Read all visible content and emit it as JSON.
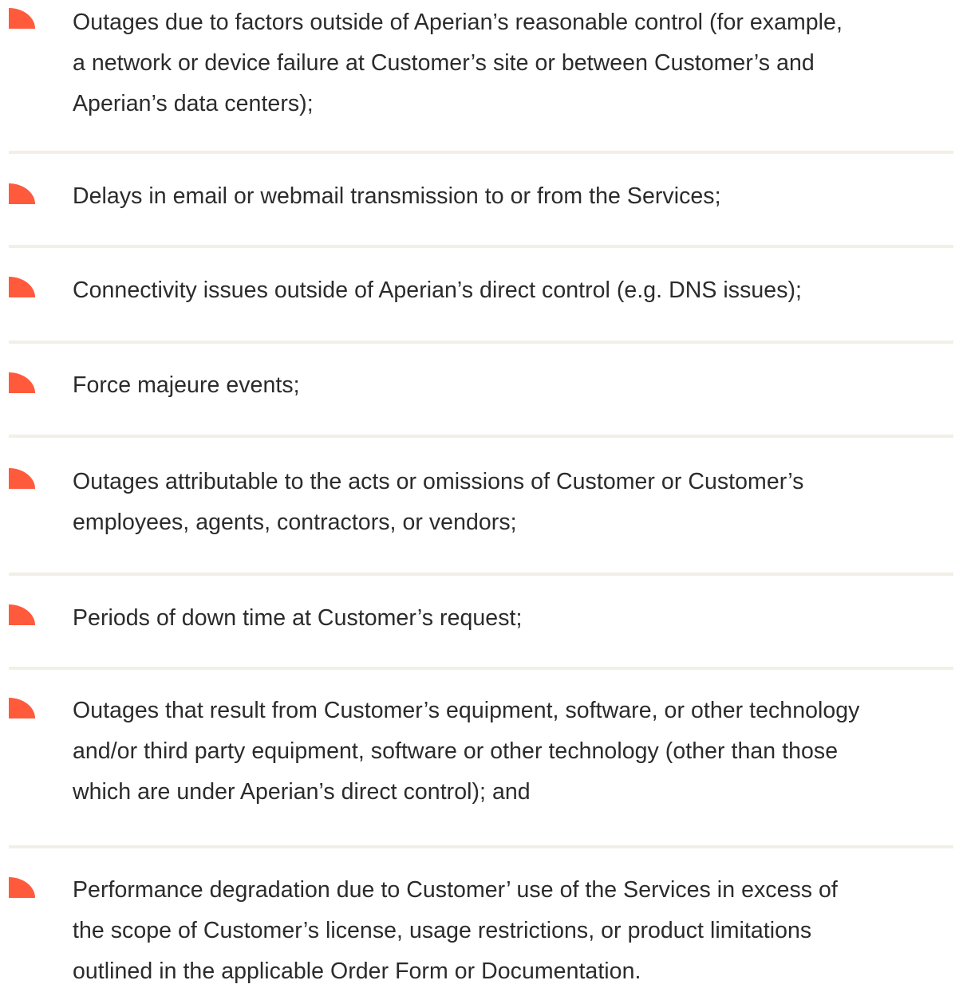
{
  "list": {
    "items": [
      {
        "lines": [
          "Outages due to factors outside of Aperian’s reasonable control (for example,",
          "a network or device failure at Customer’s site or between Customer’s and",
          "Aperian’s data centers);"
        ]
      },
      {
        "lines": [
          "Delays in email or webmail transmission to or from the Services;"
        ]
      },
      {
        "lines": [
          "Connectivity issues outside of Aperian’s direct control (e.g. DNS issues);"
        ]
      },
      {
        "lines": [
          "Force majeure events;"
        ]
      },
      {
        "lines": [
          "Outages attributable to the acts or omissions of Customer or Customer’s",
          "employees, agents, contractors, or vendors;"
        ]
      },
      {
        "lines": [
          "Periods of down time at Customer’s request;"
        ]
      },
      {
        "lines": [
          "Outages that result from Customer’s equipment, software, or other technology",
          "and/or third party equipment, software or other technology (other than those",
          "which are under Aperian’s direct control); and"
        ]
      },
      {
        "lines": [
          "Performance degradation due to Customer’ use of the Services in excess of",
          "the scope of Customer’s license, usage restrictions, or product limitations",
          "outlined in the applicable Order Form or Documentation."
        ]
      }
    ]
  },
  "colors": {
    "bullet": "#ff5a3c",
    "divider": "#f2efe6",
    "text": "#2b2b2b"
  }
}
